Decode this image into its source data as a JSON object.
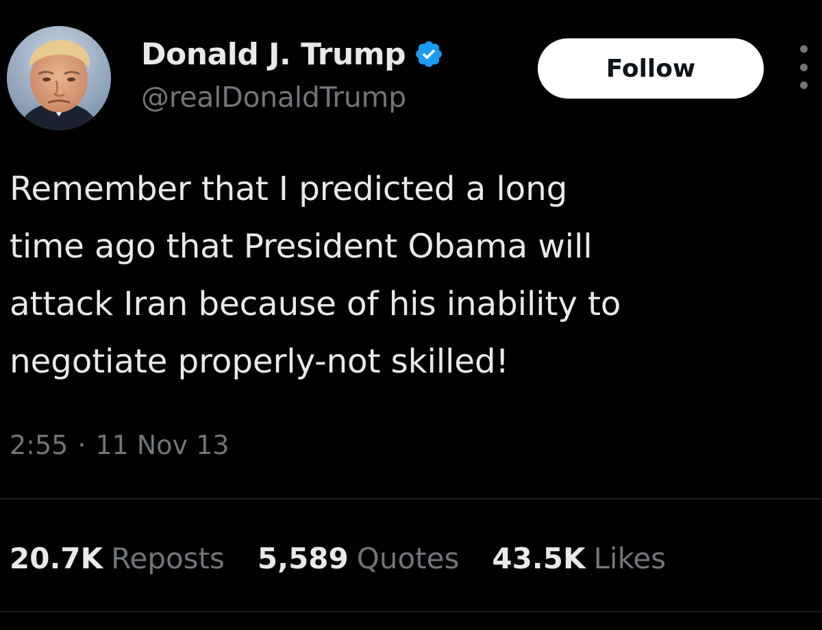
{
  "author": {
    "display_name": "Donald J. Trump",
    "handle": "@realDonaldTrump",
    "avatar_icon": "profile-photo",
    "verified_icon": "verified-badge-icon",
    "verified_color": "#1d9bf0"
  },
  "actions": {
    "follow_label": "Follow",
    "more_icon": "more-options-icon"
  },
  "tweet": {
    "text_lines": [
      "Remember that I predicted a long",
      "time ago that President Obama will",
      "attack Iran because of his inability to",
      "negotiate properly-not skilled!"
    ],
    "time": "2:55",
    "separator": "·",
    "date": "11 Nov 13"
  },
  "stats": [
    {
      "count": "20.7K",
      "label": "Reposts"
    },
    {
      "count": "5,589",
      "label": "Quotes"
    },
    {
      "count": "43.5K",
      "label": "Likes"
    }
  ],
  "colors": {
    "background": "#000000",
    "text_primary": "#e7e9ea",
    "text_secondary": "#71767b",
    "divider": "#2f3336",
    "follow_bg": "#ffffff",
    "follow_text": "#0f1419"
  }
}
